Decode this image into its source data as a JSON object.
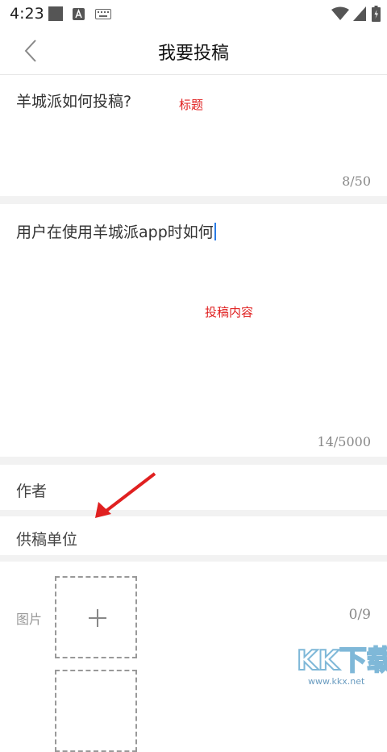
{
  "status_bar": {
    "time": "4:23"
  },
  "nav": {
    "title": "我要投稿"
  },
  "form": {
    "title_value": "羊城派如何投稿?",
    "title_counter": "8/50",
    "title_annotation": "标题",
    "content_value": "用户在使用羊城派app时如何",
    "content_counter": "14/5000",
    "content_annotation": "投稿内容",
    "author_placeholder": "作者",
    "unit_placeholder": "供稿单位",
    "photo_label": "图片",
    "photo_counter": "0/9"
  },
  "watermark": {
    "main": "KK下载",
    "sub": "www.kkx.net"
  },
  "colors": {
    "annotation": "#e02020",
    "caret": "#2a7be4",
    "gap": "#f2f2f2"
  }
}
